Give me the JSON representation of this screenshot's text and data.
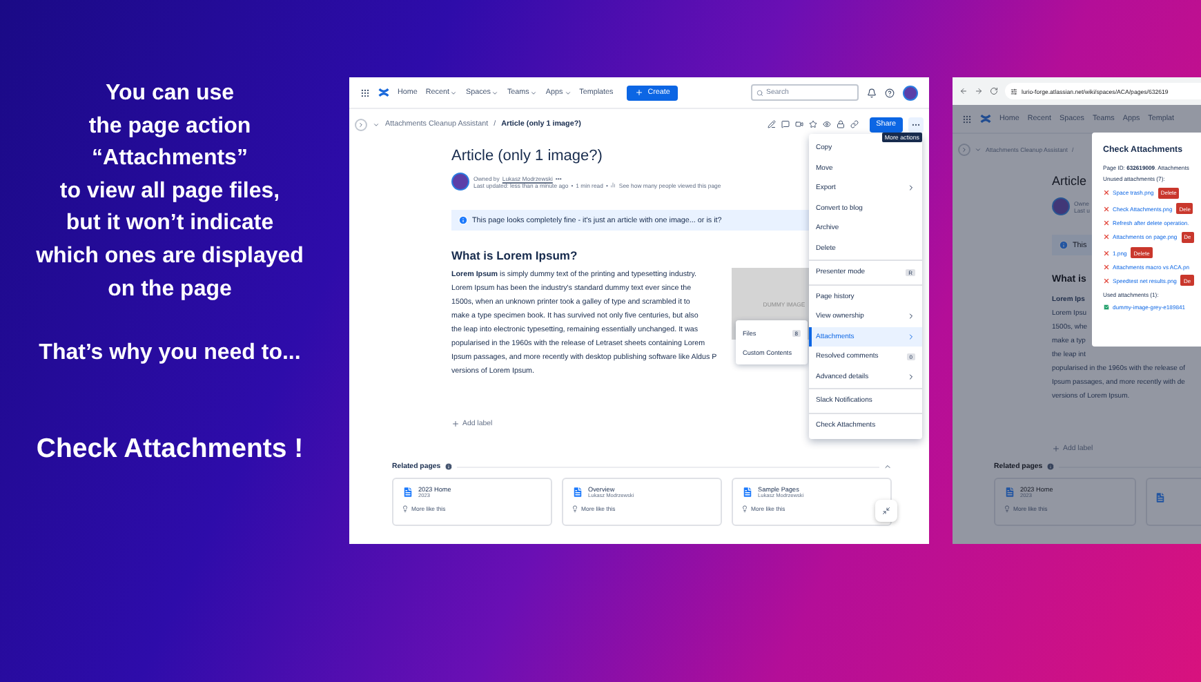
{
  "promo": {
    "lines": [
      "You can use",
      "the page action",
      "“Attachments”",
      "to view all page files,",
      "but it won’t indicate",
      "which ones are displayed",
      "on the page"
    ],
    "lead_in": "That’s why you need to...",
    "call_to_action": "Check Attachments !"
  },
  "screenshot_1": {
    "nav": {
      "items": [
        {
          "label": "Home",
          "dropdown": false
        },
        {
          "label": "Recent",
          "dropdown": true
        },
        {
          "label": "Spaces",
          "dropdown": true
        },
        {
          "label": "Teams",
          "dropdown": true
        },
        {
          "label": "Apps",
          "dropdown": true
        },
        {
          "label": "Templates",
          "dropdown": false
        }
      ],
      "create": "Create",
      "search_placeholder": "Search"
    },
    "breadcrumb": {
      "parent": "Attachments Cleanup Assistant",
      "separator": "/",
      "current": "Article (only 1 image?)"
    },
    "share": "Share",
    "tooltip": "More actions",
    "title": "Article (only 1 image?)",
    "byline": {
      "owned_by": "Owned by",
      "owner": "Lukasz Modrzewski",
      "more": "•••",
      "updated": "Last updated: less than a minute ago",
      "bullet": "•",
      "read_time": "1 min read",
      "views": "See how many people viewed this page"
    },
    "info_panel": "This page looks completely fine - it's just an article with one image... or is it?",
    "heading": "What is Lorem Ipsum?",
    "paragraph_lines": [
      "**Lorem Ipsum** is simply dummy text of the printing and typesetting industry.",
      "Lorem Ipsum has been the industry's standard dummy text ever since the",
      "1500s, when an unknown printer took a galley of type and scrambled it to",
      "make a type specimen book. It has survived not only five centuries, but also",
      "the leap into electronic typesetting, remaining essentially unchanged. It was",
      "popularised in the 1960s with the release of Letraset sheets containing Lorem",
      "Ipsum passages, and more recently with desktop publishing software like Aldus P",
      "versions of Lorem Ipsum."
    ],
    "image_label": "DUMMY IMAGE",
    "submenu": [
      {
        "label": "Files",
        "badge": "8"
      },
      {
        "label": "Custom Contents"
      }
    ],
    "add_label": "Add label",
    "related": {
      "title": "Related pages",
      "cards": [
        {
          "title": "2023 Home",
          "subtitle": "2023",
          "action": "More like this"
        },
        {
          "title": "Overview",
          "subtitle": "Lukasz Modrzewski",
          "action": "More like this"
        },
        {
          "title": "Sample Pages",
          "subtitle": "Lukasz Modrzewski",
          "action": "More like this"
        }
      ]
    },
    "menu_groups": [
      [
        {
          "label": "Copy",
          "submenu": false,
          "selected": false
        },
        {
          "label": "Move",
          "submenu": false,
          "selected": false
        },
        {
          "label": "Export",
          "submenu": true,
          "selected": false
        },
        {
          "label": "Convert to blog",
          "submenu": false,
          "selected": false
        },
        {
          "label": "Archive",
          "submenu": false,
          "selected": false
        },
        {
          "label": "Delete",
          "submenu": false,
          "selected": false
        }
      ],
      [
        {
          "label": "Presenter mode",
          "submenu": false,
          "selected": false,
          "badge": "R"
        }
      ],
      [
        {
          "label": "Page history",
          "submenu": false,
          "selected": false
        },
        {
          "label": "View ownership",
          "submenu": true,
          "selected": false
        },
        {
          "label": "Attachments",
          "submenu": true,
          "selected": true
        },
        {
          "label": "Resolved comments",
          "submenu": false,
          "selected": false,
          "badge": "0"
        },
        {
          "label": "Advanced details",
          "submenu": true,
          "selected": false
        }
      ],
      [
        {
          "label": "Slack Notifications",
          "submenu": false,
          "selected": false
        }
      ],
      [
        {
          "label": "Check Attachments",
          "submenu": false,
          "selected": false
        }
      ]
    ]
  },
  "screenshot_2": {
    "url": "lurio-forge.atlassian.net/wiki/spaces/ACA/pages/632619",
    "nav": [
      "Home",
      "Recent",
      "Spaces",
      "Teams",
      "Apps",
      "Templat"
    ],
    "breadcrumb": {
      "parent": "Attachments Cleanup Assistant",
      "separator": "/"
    },
    "title": "Article",
    "byline": [
      "Owne",
      "Last u"
    ],
    "info_panel": "This",
    "heading": "What is",
    "hidden_lines": [
      {
        "text": "Lorem Ips",
        "bold": true
      },
      {
        "text": "Lorem Ipsu",
        "bold": false
      },
      {
        "text": "1500s, whe",
        "bold": false
      },
      {
        "text": "make a typ",
        "bold": false
      },
      {
        "text": "the leap int",
        "bold": false
      }
    ],
    "lines": [
      "popularised in the 1960s with the release of",
      "Ipsum passages, and more recently with de",
      "versions of Lorem Ipsum."
    ],
    "add_label": "Add label",
    "related": {
      "title": "Related pages",
      "cards": [
        {
          "title": "2023 Home",
          "subtitle": "2023",
          "action": "More like this"
        }
      ]
    },
    "dialog": {
      "title": "Check Attachments",
      "page_id": "Page ID: **632619009**. Attachments",
      "unused_heading": "Unused attachments (7):",
      "unused": [
        {
          "name": "Space trash.png",
          "button": "Delete"
        },
        {
          "name": "Check Attachments.png",
          "button": "Dele"
        },
        {
          "name": "Refresh after delete operation."
        },
        {
          "name": "Attachments on page.png",
          "button": "De"
        },
        {
          "name": "1.png",
          "button": "Delete"
        },
        {
          "name": "Attachments macro vs ACA.pn"
        },
        {
          "name": "Speedtest net results.png",
          "button": "De"
        }
      ],
      "used_heading": "Used attachments (1):",
      "used": [
        {
          "name": "dummy-image-grey-e189841"
        }
      ]
    }
  }
}
